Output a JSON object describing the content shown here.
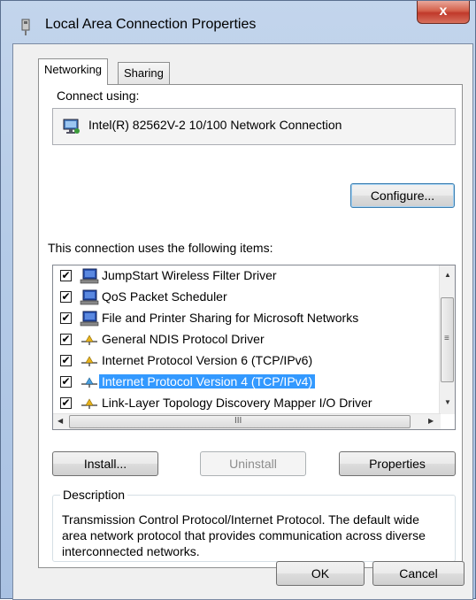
{
  "window": {
    "title": "Local Area Connection Properties",
    "close_glyph": "x"
  },
  "tabs": [
    {
      "label": "Networking"
    },
    {
      "label": "Sharing"
    }
  ],
  "connect_using": {
    "label": "Connect using:",
    "adapter": "Intel(R) 82562V-2 10/100 Network Connection",
    "configure": "Configure..."
  },
  "items": {
    "label": "This connection uses the following items:",
    "list": [
      {
        "label": "JumpStart Wireless Filter Driver",
        "icon": "network-client-icon",
        "checked": true,
        "check": "✔"
      },
      {
        "label": "QoS Packet Scheduler",
        "icon": "network-client-icon",
        "checked": true,
        "check": "✔"
      },
      {
        "label": "File and Printer Sharing for Microsoft Networks",
        "icon": "network-client-icon",
        "checked": true,
        "check": "✔"
      },
      {
        "label": "General NDIS Protocol Driver",
        "icon": "protocol-icon",
        "checked": true,
        "check": "✔"
      },
      {
        "label": "Internet Protocol Version 6 (TCP/IPv6)",
        "icon": "protocol-icon",
        "checked": true,
        "check": "✔"
      },
      {
        "label": "Internet Protocol Version 4 (TCP/IPv4)",
        "icon": "protocol-icon",
        "checked": true,
        "check": "✔",
        "selected": true
      },
      {
        "label": "Link-Layer Topology Discovery Mapper I/O Driver",
        "icon": "protocol-icon",
        "checked": true,
        "check": "✔"
      }
    ],
    "hscroll_grip": "III",
    "vscroll_grip": "≡"
  },
  "buttons": {
    "install": "Install...",
    "uninstall": "Uninstall",
    "properties": "Properties",
    "ok": "OK",
    "cancel": "Cancel"
  },
  "description": {
    "label": "Description",
    "text": "Transmission Control Protocol/Internet Protocol. The default wide area network protocol that provides communication across diverse interconnected networks."
  },
  "colors": {
    "selection": "#3399ff",
    "titlebar": "#b5cbe7",
    "close": "#c0392b"
  }
}
